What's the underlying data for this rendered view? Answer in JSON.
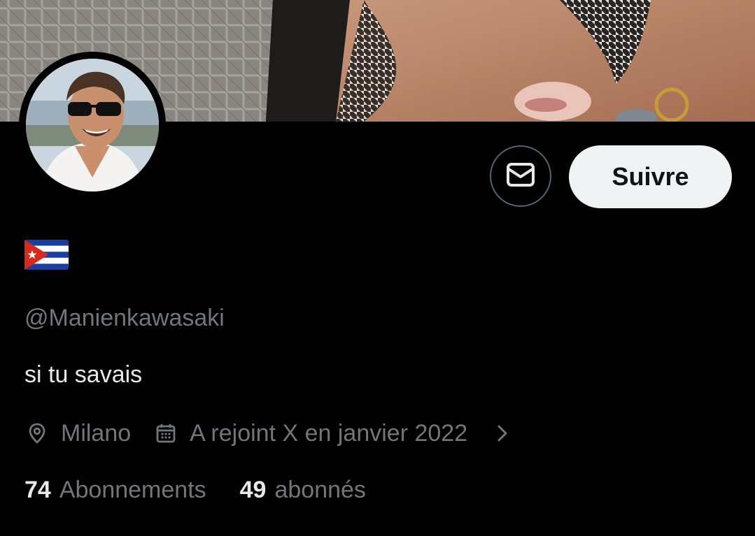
{
  "profile": {
    "handle": "@Manienkawasaki",
    "bio": "si tu savais",
    "location": "Milano",
    "joined": "A rejoint X en janvier 2022",
    "following_count": "74",
    "following_label": "Abonnements",
    "followers_count": "49",
    "followers_label": "abonnés"
  },
  "actions": {
    "follow_label": "Suivre"
  },
  "icons": {
    "message": "mail-icon",
    "location": "map-pin-icon",
    "calendar": "calendar-icon",
    "chevron": "chevron-right-icon",
    "flag": "cuba-flag"
  },
  "colors": {
    "background": "#000000",
    "primary_text": "#e7e9ea",
    "secondary_text": "#71767b",
    "follow_button_bg": "#eff3f4",
    "follow_button_text": "#0f1419",
    "border": "#536471"
  }
}
